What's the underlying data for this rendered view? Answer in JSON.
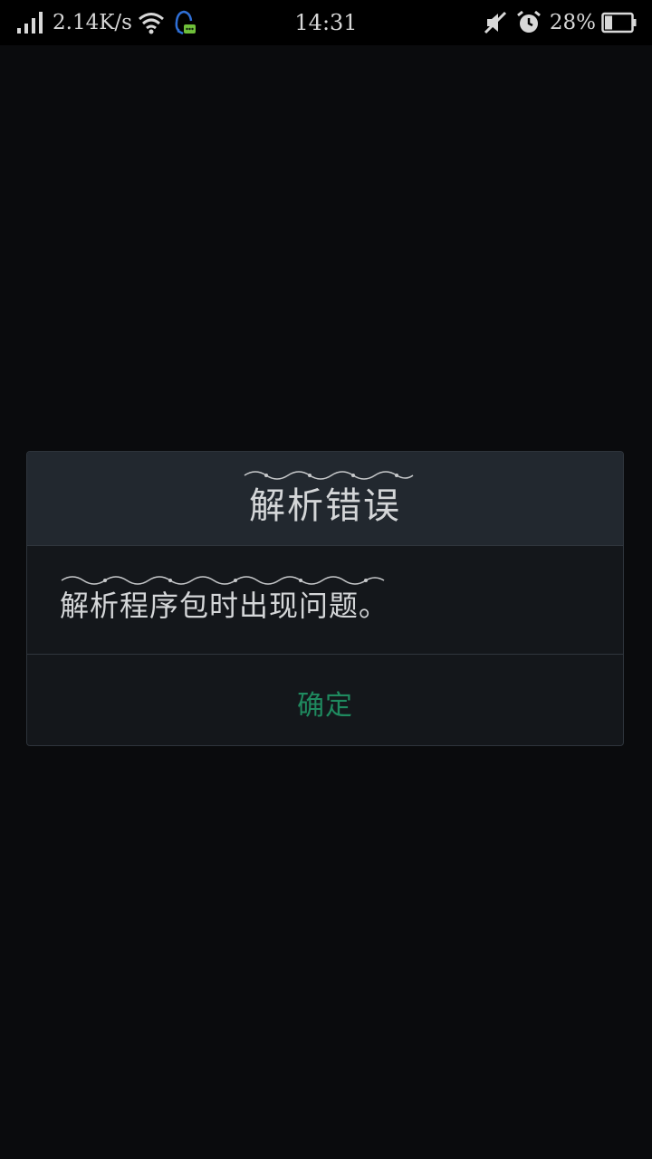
{
  "status_bar": {
    "network_speed": "2.14K/s",
    "time": "14:31",
    "battery_percent": "28%",
    "battery_level": 0.28,
    "icons": [
      "signal-icon",
      "wifi-icon",
      "qq-notification-icon",
      "mute-icon",
      "alarm-icon",
      "battery-icon"
    ]
  },
  "dialog": {
    "title": "解析错误",
    "message": "解析程序包时出现问题。",
    "confirm_label": "确定"
  },
  "colors": {
    "background": "#0a0b0d",
    "dialog_header": "#22282f",
    "dialog_body": "#14171b",
    "text": "#d4d6d8",
    "accent": "#1f8a5f"
  }
}
